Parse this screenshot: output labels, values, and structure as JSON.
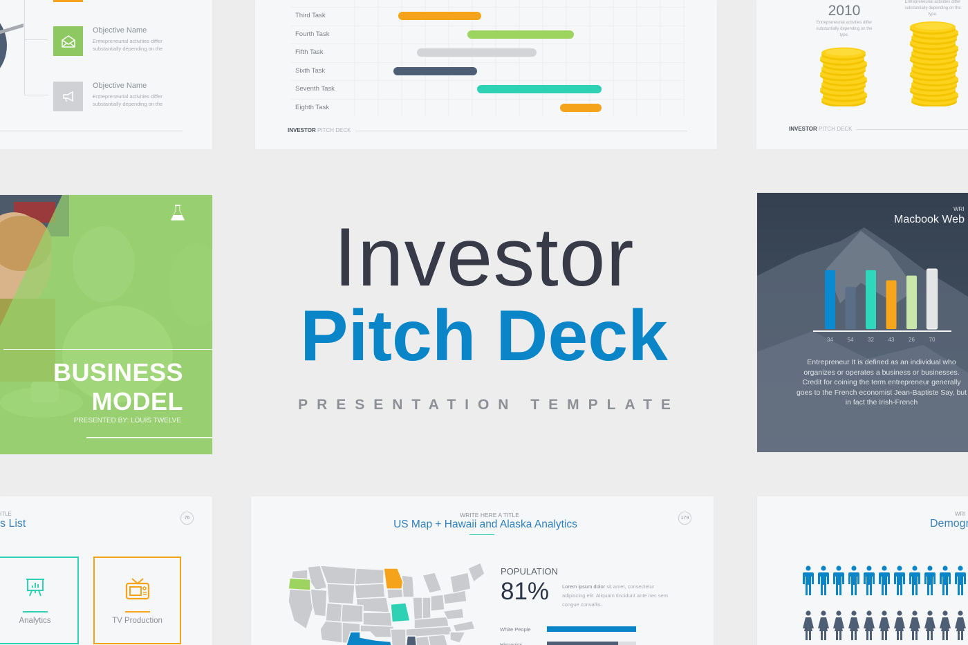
{
  "colors": {
    "background": "#ededed",
    "slide_bg": "#f6f7f9",
    "brand_blue": "#0a86c8",
    "dark_navy": "#383a47",
    "slate": "#4e5e75",
    "teal": "#2fd1b5",
    "orange": "#f5a31a",
    "lime": "#9dd45f",
    "light_gray": "#d2d4d7",
    "pale_green": "#c9e7a8",
    "coin_yellow": "#fcd21c"
  },
  "hero": {
    "line1": "Investor",
    "line2": "Pitch Deck",
    "line3": "PRESENTATION TEMPLATE"
  },
  "objectives_slide": {
    "items": [
      {
        "title": "Objective Name",
        "desc": "Entrepreneurial activities differ substantially depending on the",
        "icon": "envelope-icon",
        "color": "#8dc860"
      },
      {
        "title": "Objective Name",
        "desc": "Entrepreneurial activities differ substantially depending on the",
        "icon": "megaphone-icon",
        "color": "#cfd1d4"
      }
    ]
  },
  "gantt_slide": {
    "tasks": [
      {
        "label": "Third Task",
        "start": 0.31,
        "end": 0.49,
        "color": "#f5a31a"
      },
      {
        "label": "Fourth Task",
        "start": 0.46,
        "end": 0.69,
        "color": "#9dd45f"
      },
      {
        "label": "Fifth Task",
        "start": 0.35,
        "end": 0.61,
        "color": "#d2d4d7"
      },
      {
        "label": "Sixth Task",
        "start": 0.3,
        "end": 0.48,
        "color": "#4e5e75"
      },
      {
        "label": "Seventh Task",
        "start": 0.48,
        "end": 0.75,
        "color": "#2fd1b5"
      },
      {
        "label": "Eighth Task",
        "start": 0.66,
        "end": 0.75,
        "color": "#f5a31a"
      }
    ],
    "footer_bold": "INVESTOR",
    "footer_light": "PITCH DECK"
  },
  "coins_slide": {
    "year": "2010",
    "year_desc": "Entrepreneurial activities differ substantially depending on the type.",
    "second_desc": "Entrepreneurial activities differ substantially depending on the type.",
    "footer_bold": "INVESTOR",
    "footer_light": "PITCH DECK"
  },
  "business_slide": {
    "title_line1": "BUSINESS",
    "title_line2": "MODEL",
    "presented_by": "PRESENTED BY: LOUIS TWELVE",
    "icon": "flask-icon"
  },
  "mountain_slide": {
    "kicker": "WRI",
    "heading": "Macbook Web",
    "paragraph": "Entrepreneur  It is defined as an individual who organizes or operates a business or businesses. Credit for coining the term entrepreneur generally goes to the French economist Jean-Baptiste Say, but in fact the Irish-French"
  },
  "services_slide": {
    "kicker": "ITLE",
    "heading": "s List",
    "page_number": "76",
    "cards": [
      {
        "label": "Analytics",
        "icon": "presentation-chart-icon",
        "color": "#2fd1b5"
      },
      {
        "label": "TV Production",
        "icon": "tv-icon",
        "color": "#f5a31a"
      }
    ]
  },
  "map_slide": {
    "kicker": "WRITE HERE A TITLE",
    "heading": "US Map + Hawaii and Alaska Analytics",
    "page_number": "179",
    "population_label": "POPULATION",
    "population_value": "81%",
    "population_desc_bold": "Lorem ipsum dolor",
    "population_desc": " sit amet, consectetur adipiscing elit. Aliquam tincidunt ante nec sem congue convallis.",
    "highlighted_states": [
      {
        "state": "Oregon",
        "color": "#9dd45f"
      },
      {
        "state": "Minnesota",
        "color": "#f5a31a"
      },
      {
        "state": "Missouri",
        "color": "#2fd1b5"
      },
      {
        "state": "Texas",
        "color": "#0a86c8"
      },
      {
        "state": "Mississippi",
        "color": "#4e5e75"
      }
    ],
    "stats": [
      {
        "label": "White People",
        "value": 1.0,
        "color": "#0a86c8"
      },
      {
        "label": "Hispanics",
        "value": 0.8,
        "color": "#4e5e75"
      }
    ]
  },
  "demographics_slide": {
    "kicker": "WRI",
    "heading": "Demogr",
    "male_count": 11,
    "female_count": 11,
    "male_color": "#0a86c8",
    "female_color": "#4e5e75"
  },
  "chart_data": {
    "type": "bar",
    "title": "Macbook Web",
    "categories": [
      "34",
      "54",
      "32",
      "43",
      "26",
      "70"
    ],
    "values": [
      0.98,
      0.7,
      0.98,
      0.81,
      0.89,
      1.0
    ],
    "colors": [
      "#0a8ad0",
      "#5b6e88",
      "#2fd7bb",
      "#f7a51a",
      "#c9e7a8",
      "#e3e4e6"
    ],
    "xlabel": "",
    "ylabel": "",
    "grid": false,
    "legend": "none"
  }
}
